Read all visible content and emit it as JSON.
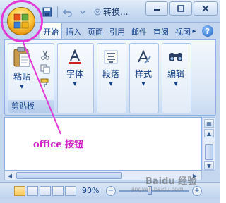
{
  "title_bar": {
    "doc_title": "转换...",
    "window_controls": [
      "minimize",
      "maximize",
      "close"
    ]
  },
  "office_button": {
    "icon": "office-logo-icon"
  },
  "quick_access": {
    "items": [
      {
        "icon": "save-icon"
      },
      {
        "icon": "undo-icon"
      },
      {
        "icon": "dropdown-icon"
      }
    ]
  },
  "tabs": [
    {
      "label": "开始",
      "active": true
    },
    {
      "label": "插入"
    },
    {
      "label": "页面"
    },
    {
      "label": "引用"
    },
    {
      "label": "邮件"
    },
    {
      "label": "审阅"
    },
    {
      "label": "视图"
    }
  ],
  "ribbon": {
    "clipboard": {
      "paste_label": "粘贴",
      "group_label": "剪贴板",
      "small_icons": [
        "cut-icon",
        "copy-icon",
        "format-painter-icon"
      ]
    },
    "font": {
      "label": "字体",
      "icon": "font-color-icon"
    },
    "paragraph": {
      "label": "段落",
      "icon": "paragraph-icon"
    },
    "styles": {
      "label": "样式",
      "icon": "styles-icon"
    },
    "editing": {
      "label": "编辑",
      "icon": "find-icon"
    }
  },
  "annotation": {
    "text": "office 按钮"
  },
  "status_bar": {
    "zoom": "90%",
    "zoom_level_percent": 90
  },
  "watermark": {
    "text": "Baidu 经验",
    "sub": "jingyan.baidu.com"
  },
  "colors": {
    "accent": "#15428b",
    "highlight": "#e23ad6",
    "ribbon_bg": "#dbe7f6"
  }
}
